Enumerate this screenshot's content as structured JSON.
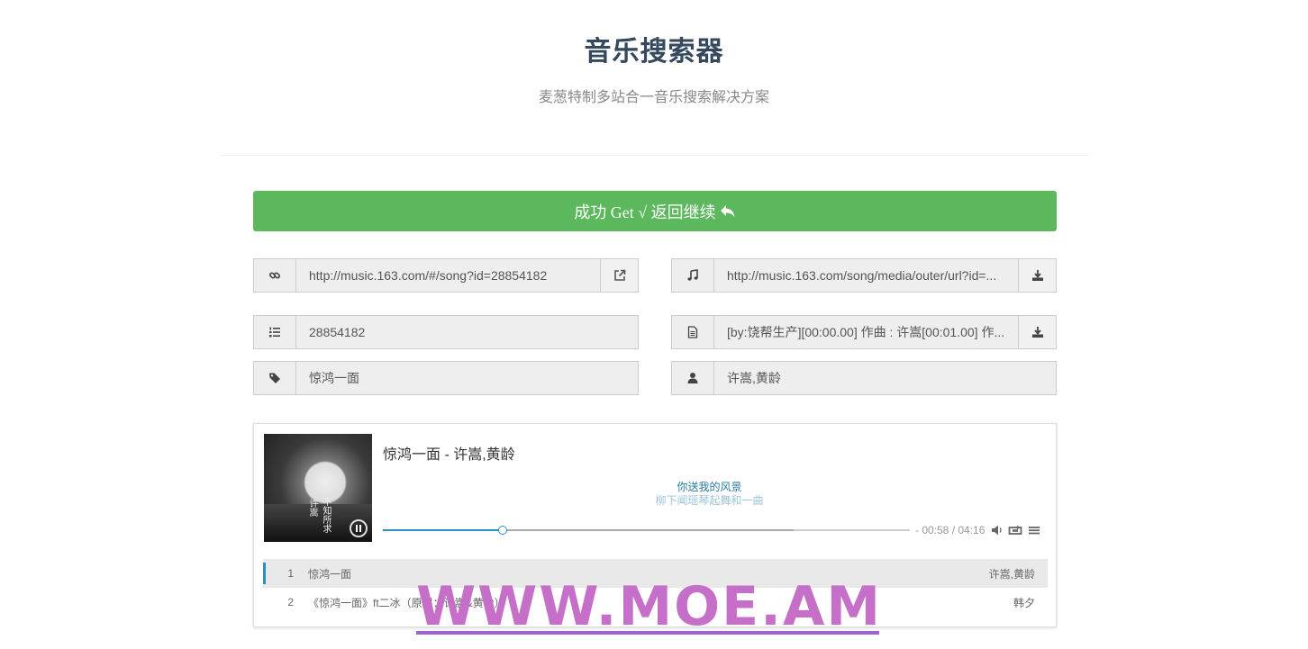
{
  "header": {
    "title": "音乐搜索器",
    "subtitle": "麦葱特制多站合一音乐搜索解决方案"
  },
  "success_button": {
    "label": "成功 Get √ 返回继续",
    "icon": "reply-icon",
    "color": "#5cb85c"
  },
  "fields": {
    "song_link": {
      "icon": "link-icon",
      "value": "http://music.163.com/#/song?id=28854182",
      "action_icon": "external-link-icon"
    },
    "audio_url": {
      "icon": "music-note-icon",
      "value": "http://music.163.com/song/media/outer/url?id=...",
      "action_icon": "download-icon"
    },
    "song_id": {
      "icon": "list-ol-icon",
      "value": "28854182"
    },
    "lyrics": {
      "icon": "file-text-icon",
      "value": "[by:饶帮生产][00:00.00] 作曲 : 许嵩[00:01.00] 作...",
      "action_icon": "download-icon"
    },
    "song_name": {
      "icon": "tag-icon",
      "value": "惊鸿一面"
    },
    "artist": {
      "icon": "user-icon",
      "value": "许嵩,黄龄"
    }
  },
  "player": {
    "title": "惊鸿一面 - 许嵩,黄龄",
    "cover_text_a": "不知所求",
    "cover_text_b": "许嵩",
    "lyric_current": "你送我的风景",
    "lyric_next": "柳下闻瑶琴起舞和一曲",
    "time": "- 00:58 / 04:16",
    "progress_played": 0.227,
    "progress_loaded": 0.78,
    "accent_color": "#2a8fc7",
    "controls": [
      "volume-icon",
      "loop-icon",
      "menu-icon"
    ],
    "playlist": [
      {
        "num": "1",
        "name": "惊鸿一面",
        "artist": "许嵩,黄龄",
        "active": true
      },
      {
        "num": "2",
        "name": "《惊鸿一面》ft二冰（原唱：许嵩&黄龄）",
        "artist": "韩夕",
        "active": false
      }
    ]
  },
  "watermark": "WWW.MOE.AM"
}
